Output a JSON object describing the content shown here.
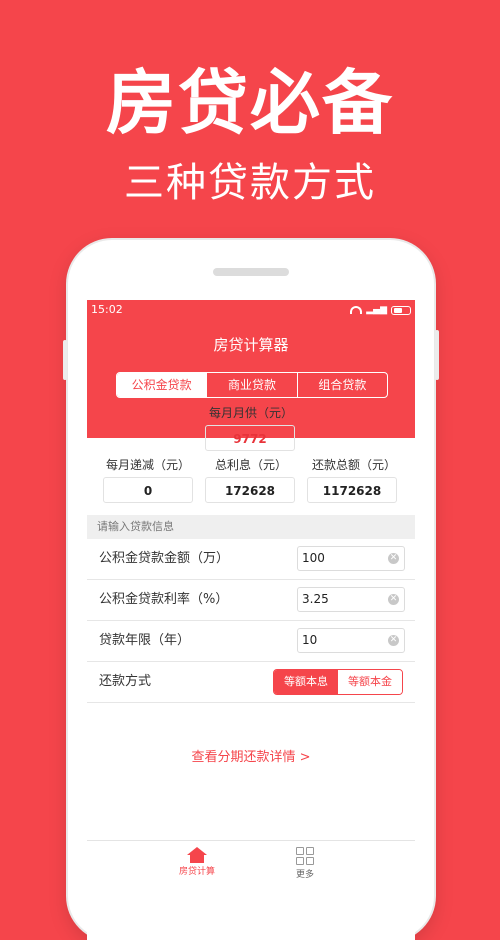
{
  "banner": {
    "title": "房贷必备",
    "subtitle": "三种贷款方式"
  },
  "status": {
    "time": "15:02"
  },
  "app": {
    "title": "房贷计算器",
    "tabs": [
      "公积金贷款",
      "商业贷款",
      "组合贷款"
    ],
    "active_tab": 0
  },
  "summary": {
    "monthly_payment_label": "每月月供（元）",
    "monthly_payment_value": "9772",
    "monthly_decrease_label": "每月递减（元）",
    "monthly_decrease_value": "0",
    "total_interest_label": "总利息（元）",
    "total_interest_value": "172628",
    "total_repayment_label": "还款总额（元）",
    "total_repayment_value": "1172628"
  },
  "form": {
    "section_title": "请输入贷款信息",
    "fields": [
      {
        "label": "公积金贷款金额（万）",
        "value": "100"
      },
      {
        "label": "公积金贷款利率（%）",
        "value": "3.25"
      },
      {
        "label": "贷款年限（年）",
        "value": "10"
      }
    ],
    "repayment_method_label": "还款方式",
    "repayment_options": [
      "等额本息",
      "等额本金"
    ],
    "repayment_selected": 0
  },
  "detail_link": "查看分期还款详情 >",
  "bottom_nav": [
    {
      "label": "房贷计算",
      "icon": "home-icon",
      "active": true
    },
    {
      "label": "更多",
      "icon": "grid-icon",
      "active": false
    }
  ],
  "colors": {
    "accent": "#f5454b",
    "monthly_value": "#e8333a"
  }
}
